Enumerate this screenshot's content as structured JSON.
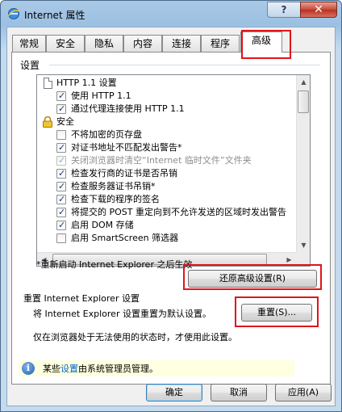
{
  "window": {
    "title": "Internet 属性",
    "help_label": "?",
    "close_label": "✕"
  },
  "tabs": [
    {
      "label": "常规"
    },
    {
      "label": "安全"
    },
    {
      "label": "隐私"
    },
    {
      "label": "内容"
    },
    {
      "label": "连接"
    },
    {
      "label": "程序"
    },
    {
      "label": "高级",
      "active": true
    }
  ],
  "settings": {
    "group_label": "设置",
    "items": [
      {
        "type": "category",
        "icon": "document-icon",
        "label": "HTTP 1.1 设置"
      },
      {
        "type": "check",
        "checked": true,
        "label": "使用 HTTP 1.1"
      },
      {
        "type": "check",
        "checked": true,
        "label": "通过代理连接使用 HTTP 1.1"
      },
      {
        "type": "category",
        "icon": "lock-icon",
        "label": "安全"
      },
      {
        "type": "check",
        "checked": false,
        "label": "不将加密的页存盘"
      },
      {
        "type": "check",
        "checked": true,
        "label": "对证书地址不匹配发出警告*"
      },
      {
        "type": "check",
        "checked": true,
        "disabled": true,
        "label": "关闭浏览器时清空“Internet 临时文件”文件夹"
      },
      {
        "type": "check",
        "checked": true,
        "label": "检查发行商的证书是否吊销"
      },
      {
        "type": "check",
        "checked": true,
        "label": "检查服务器证书吊销*"
      },
      {
        "type": "check",
        "checked": true,
        "label": "检查下载的程序的签名"
      },
      {
        "type": "check",
        "checked": true,
        "label": "将提交的 POST 重定向到不允许发送的区域时发出警告"
      },
      {
        "type": "check",
        "checked": true,
        "label": "启用 DOM 存储"
      },
      {
        "type": "check",
        "checked": false,
        "label": "启用 SmartScreen 筛选器"
      }
    ],
    "restart_note": "*重新启动 Internet Explorer 之后生效",
    "restore_button": "还原高级设置(R)"
  },
  "reset": {
    "heading": "重置 Internet Explorer 设置",
    "description": "将 Internet Explorer 设置重置为默认设置。",
    "button": "重置(S)...",
    "note": "仅在浏览器处于无法使用的状态时，才使用此设置。"
  },
  "admin_info": {
    "prefix": "某些",
    "link": "设置",
    "suffix": "由系统管理员管理。"
  },
  "footer": {
    "ok": "确定",
    "cancel": "取消",
    "apply": "应用(A)"
  },
  "colors": {
    "highlight_box": "#e0141a",
    "link": "#0066cc",
    "info_bar": "#ffffe1"
  }
}
